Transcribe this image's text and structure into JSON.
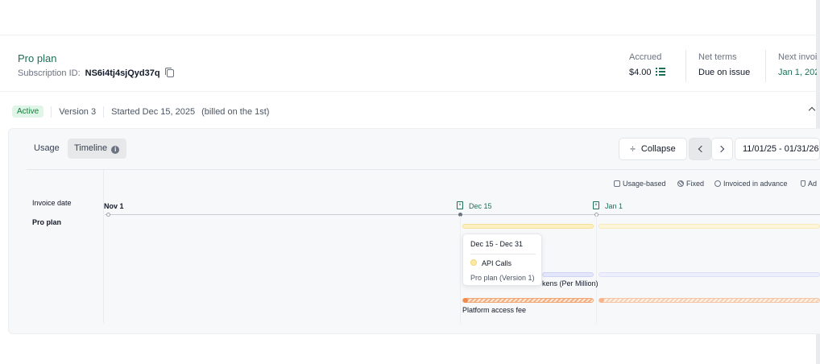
{
  "header": {
    "plan_name": "Pro plan",
    "subscription_label": "Subscription ID:",
    "subscription_id": "NS6i4tj4sjQyd37q"
  },
  "stats": {
    "accrued_label": "Accrued",
    "accrued_value": "$4.00",
    "net_terms_label": "Net terms",
    "net_terms_value": "Due on issue",
    "next_invoice_label": "Next invoi",
    "next_invoice_value": "Jan 1, 202"
  },
  "status": {
    "badge": "Active",
    "version": "Version 3",
    "started": "Started Dec 15, 2025",
    "billed": "(billed on the 1st)"
  },
  "tabs": [
    {
      "label": "Usage",
      "active": false
    },
    {
      "label": "Timeline",
      "active": true
    }
  ],
  "controls": {
    "collapse_label": "Collapse",
    "date_range": "11/01/25 - 01/31/26"
  },
  "legend": {
    "usage_based": "Usage-based",
    "fixed": "Fixed",
    "invoiced_in_advance": "Invoiced in advance",
    "extra": "Ad"
  },
  "timeline": {
    "row_labels": {
      "invoice_date": "Invoice date",
      "plan": "Pro plan"
    },
    "dates": {
      "nov1": "Nov 1",
      "dec15": "Dec 15",
      "jan1": "Jan 1"
    },
    "bars": {
      "api_calls": "API Calls",
      "tokens": "kens (Per Million)",
      "platform_fee": "Platform access fee"
    }
  },
  "tooltip": {
    "range": "Dec 15 - Dec 31",
    "item": "API Calls",
    "plan": "Pro plan (Version 1)"
  },
  "colors": {
    "brand": "#1d6f57",
    "badge_bg": "#def5e7",
    "api_bar": "#fdf1c4",
    "token_bar": "#e4e7fb",
    "fee_bar": "#f3b183"
  },
  "icons": {
    "copy": "copy-icon",
    "list": "list-icon",
    "info": "info-icon",
    "collapse": "collapse-icon",
    "prev": "chevron-left-icon",
    "next": "chevron-right-icon",
    "invoice": "invoice-icon"
  }
}
